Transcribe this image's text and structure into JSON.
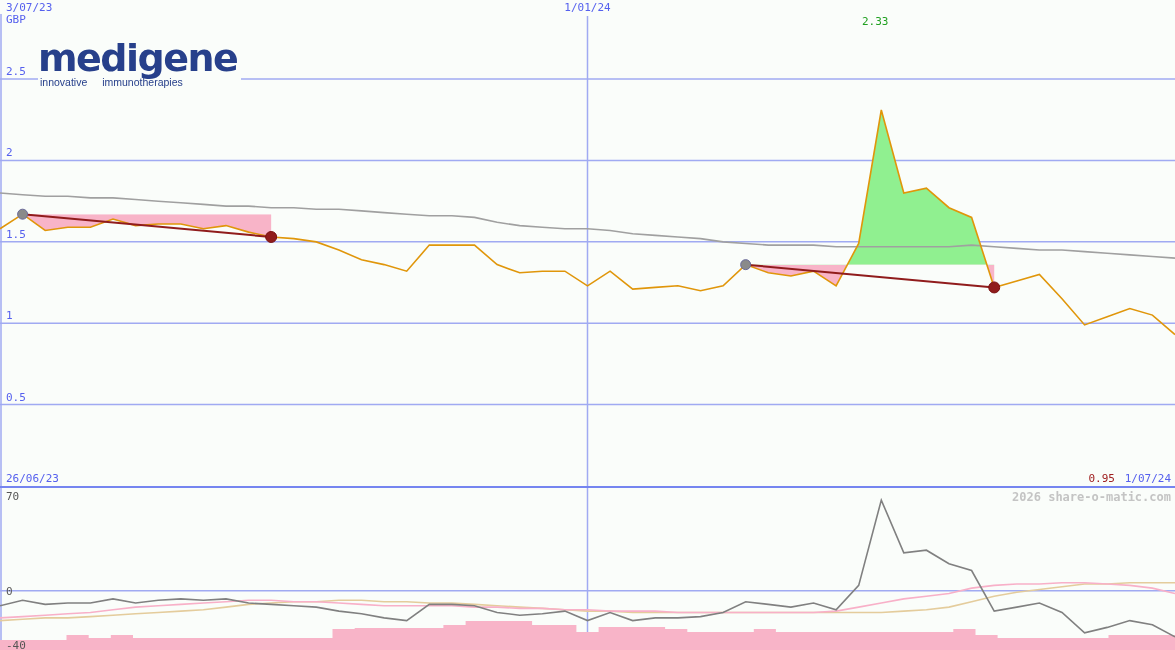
{
  "logo": {
    "wordmark": "medigene",
    "tagline": "innovative immunotherapies"
  },
  "price_chart": {
    "first_date": "3/07/23",
    "start_date": "26/06/23",
    "high_label": "2.33",
    "low_label": "0.95",
    "end_date": "1/07/24",
    "chart_data": {
      "type": "line",
      "ylabel": "GBP",
      "grid": true,
      "categories": [
        null,
        null,
        null,
        null,
        null,
        null,
        null,
        null,
        null,
        null,
        null,
        null,
        null,
        null,
        null,
        null,
        null,
        null,
        null,
        null,
        null,
        null,
        null,
        null,
        null,
        null,
        "1/01/24",
        null,
        null,
        null,
        null,
        null,
        null,
        null,
        null,
        null,
        null,
        null,
        null,
        null,
        null,
        null,
        null,
        null,
        null,
        null,
        null,
        null,
        null,
        null,
        null,
        null,
        null
      ],
      "ylim": [
        0,
        2.9
      ],
      "yticks": [
        {
          "value": 0.5,
          "label": "0.5"
        },
        {
          "value": 1,
          "label": "1"
        },
        {
          "value": 1.5,
          "label": "1.5"
        },
        {
          "value": 2,
          "label": "2"
        },
        {
          "value": 2.5,
          "label": "2.5"
        }
      ],
      "series": [
        {
          "color": "#a0a0a0",
          "values": [
            1.8,
            1.79,
            1.78,
            1.78,
            1.77,
            1.77,
            1.76,
            1.75,
            1.74,
            1.73,
            1.72,
            1.72,
            1.71,
            1.71,
            1.7,
            1.7,
            1.69,
            1.68,
            1.67,
            1.66,
            1.66,
            1.65,
            1.62,
            1.6,
            1.59,
            1.58,
            1.58,
            1.57,
            1.55,
            1.54,
            1.53,
            1.52,
            1.5,
            1.49,
            1.48,
            1.48,
            1.48,
            1.47,
            1.47,
            1.47,
            1.47,
            1.47,
            1.47,
            1.48,
            1.47,
            1.46,
            1.45,
            1.45,
            1.44,
            1.43,
            1.42,
            1.41,
            1.4
          ]
        },
        {
          "color": "#e0960a",
          "values": [
            1.58,
            1.67,
            1.57,
            1.59,
            1.59,
            1.64,
            1.6,
            1.61,
            1.61,
            1.58,
            1.6,
            1.56,
            1.53,
            1.52,
            1.5,
            1.45,
            1.39,
            1.36,
            1.32,
            1.48,
            1.48,
            1.48,
            1.36,
            1.31,
            1.32,
            1.32,
            1.23,
            1.32,
            1.21,
            1.22,
            1.23,
            1.2,
            1.23,
            1.36,
            1.31,
            1.29,
            1.32,
            1.23,
            1.49,
            2.31,
            1.8,
            1.83,
            1.71,
            1.65,
            1.22,
            1.26,
            1.3,
            1.15,
            0.99,
            1.04,
            1.09,
            1.05,
            0.93
          ]
        },
        {
          "color": "#901c1c",
          "values": [
            null,
            1.67,
            null,
            null,
            null,
            null,
            null,
            null,
            null,
            null,
            null,
            null,
            1.53,
            null,
            null,
            null,
            null,
            null,
            null,
            null,
            null,
            null,
            null,
            null,
            null,
            null,
            null,
            null,
            null,
            null,
            null,
            null,
            null,
            null,
            null,
            null,
            null,
            null,
            null,
            null,
            null,
            null,
            null,
            null,
            null,
            null,
            null,
            null,
            null,
            null,
            null,
            null,
            null
          ]
        },
        {
          "color": "#901c1c",
          "values": [
            null,
            null,
            null,
            null,
            null,
            null,
            null,
            null,
            null,
            null,
            null,
            null,
            null,
            null,
            null,
            null,
            null,
            null,
            null,
            null,
            null,
            null,
            null,
            null,
            null,
            null,
            null,
            null,
            null,
            null,
            null,
            null,
            null,
            1.36,
            null,
            null,
            null,
            null,
            null,
            null,
            null,
            null,
            null,
            null,
            1.22,
            null,
            null,
            null,
            null,
            null,
            null,
            null,
            null
          ]
        }
      ]
    }
  },
  "indicator_chart": {
    "credit": "2026 share-o-matic.com",
    "chart_data": {
      "type": "line",
      "categories": [
        null,
        null,
        null,
        null,
        null,
        null,
        null,
        null,
        null,
        null,
        null,
        null,
        null,
        null,
        null,
        null,
        null,
        null,
        null,
        null,
        null,
        null,
        null,
        null,
        null,
        null,
        null,
        null,
        null,
        null,
        null,
        null,
        null,
        null,
        null,
        null,
        null,
        null,
        null,
        null,
        null,
        null,
        null,
        null,
        null,
        null,
        null,
        null,
        null,
        null,
        null,
        null,
        null
      ],
      "ylim": [
        -40,
        70
      ],
      "yticks": [
        {
          "value": 70,
          "label": "70"
        },
        {
          "value": 0,
          "label": "0"
        },
        {
          "value": -40,
          "label": "-40"
        }
      ],
      "series": [
        {
          "color": "#e4cc9c",
          "values": [
            -22,
            -21,
            -20,
            -20,
            -19,
            -18,
            -17,
            -16,
            -15,
            -14,
            -12,
            -10,
            -9,
            -8,
            -8,
            -7,
            -7,
            -8,
            -8,
            -9,
            -9,
            -10,
            -11,
            -12,
            -13,
            -14,
            -15,
            -15,
            -16,
            -16,
            -16,
            -16,
            -16,
            -16,
            -16,
            -16,
            -16,
            -16,
            -16,
            -16,
            -15,
            -14,
            -12,
            -8,
            -4,
            -1,
            1,
            3,
            5,
            5,
            6,
            6,
            6
          ]
        },
        {
          "color": "#f8b0c8",
          "values": [
            -20,
            -19,
            -18,
            -17,
            -16,
            -14,
            -12,
            -11,
            -10,
            -9,
            -8,
            -7,
            -7,
            -8,
            -8,
            -9,
            -10,
            -11,
            -11,
            -11,
            -11,
            -12,
            -12,
            -13,
            -13,
            -14,
            -14,
            -15,
            -15,
            -15,
            -16,
            -16,
            -16,
            -16,
            -16,
            -16,
            -16,
            -15,
            -12,
            -9,
            -6,
            -4,
            -2,
            2,
            4,
            5,
            5,
            6,
            6,
            5,
            4,
            2,
            -2
          ]
        },
        {
          "color": "#808080",
          "values": [
            -11,
            -7,
            -10,
            -9,
            -9,
            -6,
            -9,
            -7,
            -6,
            -7,
            -6,
            -9,
            -10,
            -11,
            -12,
            -15,
            -17,
            -20,
            -22,
            -10,
            -10,
            -11,
            -16,
            -18,
            -17,
            -15,
            -22,
            -16,
            -22,
            -20,
            -20,
            -19,
            -16,
            -8,
            -10,
            -12,
            -9,
            -14,
            4,
            67,
            28,
            30,
            20,
            15,
            -15,
            -12,
            -9,
            -16,
            -31,
            -27,
            -22,
            -25,
            -34
          ]
        }
      ]
    }
  }
}
